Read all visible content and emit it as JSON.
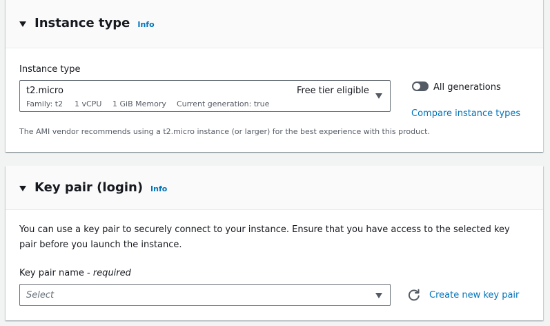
{
  "instance_type_panel": {
    "title": "Instance type",
    "info": "Info",
    "field_label": "Instance type",
    "selected": {
      "value": "t2.micro",
      "badge": "Free tier eligible",
      "family": "Family: t2",
      "vcpu": "1 vCPU",
      "memory": "1 GiB Memory",
      "generation": "Current generation: true"
    },
    "toggle": {
      "label": "All generations",
      "on": false
    },
    "compare_link": "Compare instance types",
    "note": "The AMI vendor recommends using a t2.micro instance (or larger) for the best experience with this product."
  },
  "key_pair_panel": {
    "title": "Key pair (login)",
    "info": "Info",
    "description": "You can use a key pair to securely connect to your instance. Ensure that you have access to the selected key pair before you launch the instance.",
    "field_label": "Key pair name - ",
    "field_label_required": "required",
    "select_placeholder": "Select",
    "create_link": "Create new key pair"
  },
  "colors": {
    "link": "#0073bb",
    "text": "#16191f",
    "secondary_text": "#545b64",
    "page_background": "#f2f3f3"
  },
  "icons": [
    "caret-down-icon",
    "dropdown-triangle-icon",
    "refresh-icon"
  ]
}
